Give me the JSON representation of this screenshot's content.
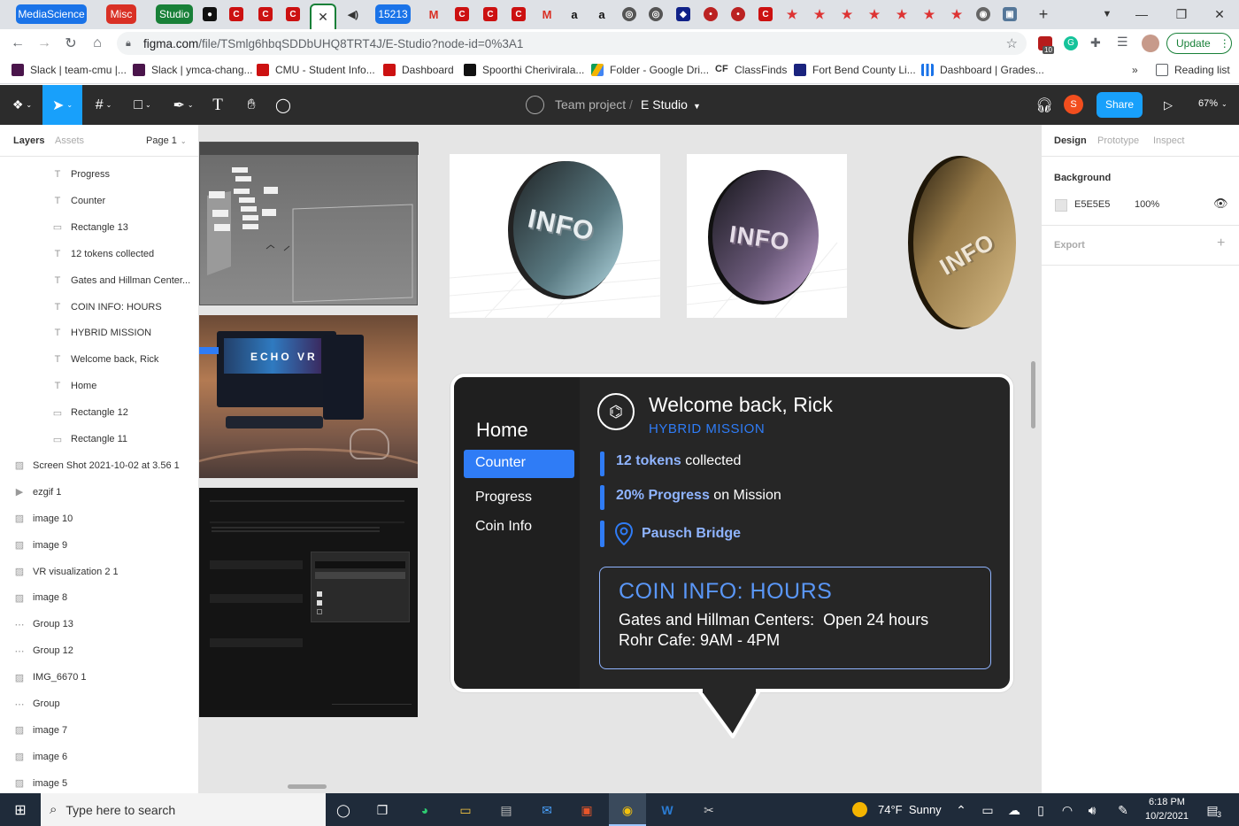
{
  "browser": {
    "tabs": [
      {
        "label": "MediaScience",
        "color": "#1a73e8"
      },
      {
        "label": "Misc",
        "color": "#d93025"
      },
      {
        "label": "Studio",
        "color": "#188038"
      },
      {
        "label": "15213",
        "color": "#1a73e8"
      }
    ],
    "url_host": "figma.com",
    "url_path": "/file/TSmlg6hbqSDDbUHQ8TRT4J/E-Studio?node-id=0%3A1",
    "update_label": "Update",
    "extension_badge": "10",
    "bookmarks": [
      "Slack | team-cmu |...",
      "Slack | ymca-chang...",
      "CMU - Student Info...",
      "Dashboard",
      "Spoorthi Cherivirala...",
      "Folder - Google Dri...",
      "ClassFinds",
      "Fort Bend County Li...",
      "Dashboard | Grades..."
    ],
    "bookmark_overflow": "»",
    "reading_list": "Reading list"
  },
  "figma": {
    "team": "Team project",
    "separator": "/",
    "file": "E Studio",
    "avatar_letter": "S",
    "share_label": "Share",
    "zoom": "67%",
    "left_tabs": {
      "layers": "Layers",
      "assets": "Assets",
      "page": "Page 1"
    },
    "layers": [
      {
        "name": "Progress",
        "icon": "T",
        "indent": 1
      },
      {
        "name": "Counter",
        "icon": "T",
        "indent": 1
      },
      {
        "name": "Rectangle 13",
        "icon": "▭",
        "indent": 1
      },
      {
        "name": "12 tokens collected",
        "icon": "T",
        "indent": 1
      },
      {
        "name": "Gates and Hillman Center...",
        "icon": "T",
        "indent": 1
      },
      {
        "name": "COIN INFO: HOURS",
        "icon": "T",
        "indent": 1
      },
      {
        "name": "HYBRID MISSION",
        "icon": "T",
        "indent": 1
      },
      {
        "name": "Welcome back, Rick",
        "icon": "T",
        "indent": 1
      },
      {
        "name": "Home",
        "icon": "T",
        "indent": 1
      },
      {
        "name": "Rectangle 12",
        "icon": "▭",
        "indent": 1
      },
      {
        "name": "Rectangle 11",
        "icon": "▭",
        "indent": 1
      },
      {
        "name": "Screen Shot 2021-10-02 at 3.56 1",
        "icon": "▨",
        "indent": 0
      },
      {
        "name": "ezgif 1",
        "icon": "▶",
        "indent": 0
      },
      {
        "name": "image 10",
        "icon": "▨",
        "indent": 0
      },
      {
        "name": "image 9",
        "icon": "▨",
        "indent": 0
      },
      {
        "name": "VR visualization 2 1",
        "icon": "▨",
        "indent": 0
      },
      {
        "name": "image 8",
        "icon": "▨",
        "indent": 0
      },
      {
        "name": "Group 13",
        "icon": "⋯",
        "indent": 0
      },
      {
        "name": "Group 12",
        "icon": "⋯",
        "indent": 0
      },
      {
        "name": "IMG_6670 1",
        "icon": "▨",
        "indent": 0
      },
      {
        "name": "Group",
        "icon": "⋯",
        "indent": 0
      },
      {
        "name": "image 7",
        "icon": "▨",
        "indent": 0
      },
      {
        "name": "image 6",
        "icon": "▨",
        "indent": 0
      },
      {
        "name": "image 5",
        "icon": "▨",
        "indent": 0
      }
    ],
    "right_tabs": {
      "design": "Design",
      "prototype": "Prototype",
      "inspect": "Inspect"
    },
    "background_label": "Background",
    "background_hex": "E5E5E5",
    "background_opacity": "100%",
    "export_label": "Export",
    "help_label": "?"
  },
  "canvas": {
    "coin_text": "INFO",
    "vr_brand": "ECHO VR",
    "card": {
      "nav": [
        "Home",
        "Counter",
        "Progress",
        "Coin Info"
      ],
      "active_nav": "Counter",
      "welcome": "Welcome back, Rick",
      "mission": "HYBRID MISSION",
      "stat1_bold": "12 tokens",
      "stat1_rest": " collected",
      "stat2_bold": "20% Progress",
      "stat2_rest": " on Mission",
      "location": "Pausch Bridge",
      "coin_title": "COIN INFO: HOURS",
      "coin_line1": "Gates and Hillman Centers:  Open 24 hours",
      "coin_line2": "Rohr Cafe: 9AM - 4PM"
    },
    "accent": "#2f7cf6"
  },
  "taskbar": {
    "search_placeholder": "Type here to search",
    "weather": "74°F  Sunny",
    "time": "6:18 PM",
    "date": "10/2/2021",
    "notif_count": "3"
  }
}
